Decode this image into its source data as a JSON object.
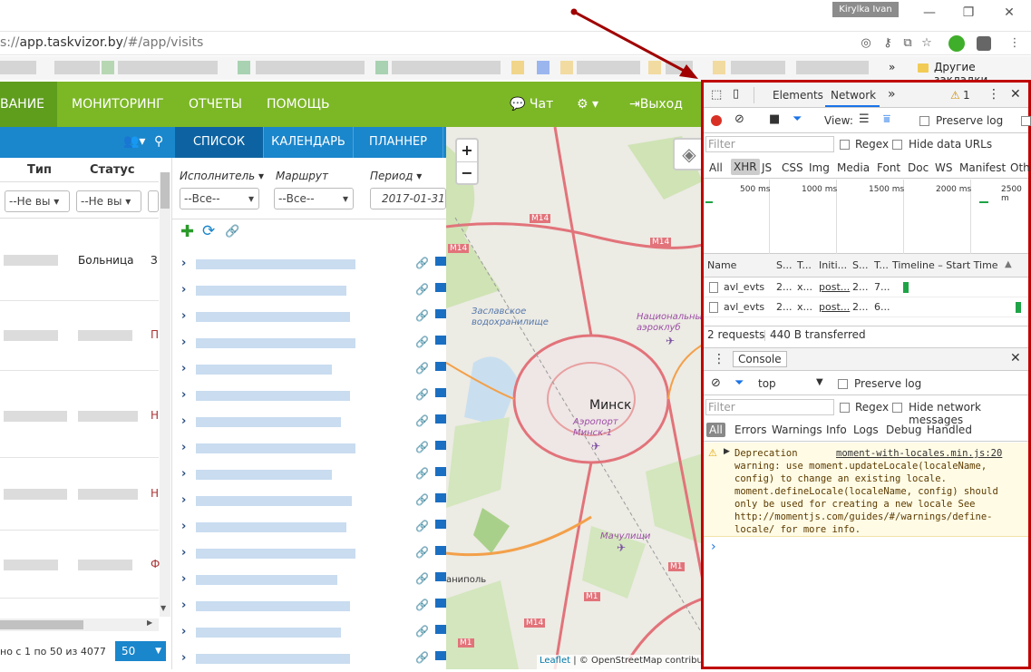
{
  "browser": {
    "user_chip": "Kirylka Ivan",
    "url_prefix": "s://",
    "url_main": "app.taskvizor.by",
    "url_rest": "/#/app/visits",
    "bookmarks_more": "»",
    "bookmarks_folder": "Другие закладки"
  },
  "nav": {
    "items": [
      "ВАНИЕ",
      "МОНИТОРИНГ",
      "ОТЧЕТЫ",
      "ПОМОЩЬ"
    ],
    "chat": "Чат",
    "logout": "Выход"
  },
  "left_grid": {
    "col_type": "Тип",
    "col_status": "Статус",
    "filter_type": "--Не вы",
    "filter_status": "--Не вы",
    "row1_status": "Больница",
    "row1_extra": "З",
    "row_extras": [
      "П",
      "Н",
      "Н",
      "Ф"
    ],
    "pager_text": "но с 1 по 50 из 4077",
    "page_size": "50"
  },
  "tabs": [
    "СПИСОК",
    "КАЛЕНДАРЬ",
    "ПЛАННЕР"
  ],
  "filters": {
    "executor_label": "Исполнитель",
    "route_label": "Маршрут",
    "period_label": "Период",
    "executor_value": "--Все--",
    "route_value": "--Все--",
    "period_value": "2017-01-31"
  },
  "map": {
    "zoom_in": "+",
    "zoom_out": "−",
    "city": "Минск",
    "airport": "Аэропорт Минск-1",
    "reservoir": "Заславское водохранилище",
    "national_airport": "Национальный аэроклуб",
    "machulishchy": "Мачулищи",
    "annopol": "аниполь",
    "roads": [
      "M14",
      "M14",
      "M14",
      "M14",
      "M1",
      "M1",
      "M1"
    ],
    "attribution_link": "Leaflet",
    "attribution_rest": "| © OpenStreetMap contribute"
  },
  "devtools": {
    "tabs": [
      "Elements",
      "Network"
    ],
    "more": "»",
    "warn_count": "1",
    "view_label": "View:",
    "preserve_log": "Preserve log",
    "filter_placeholder": "Filter",
    "regex": "Regex",
    "hide_data_urls": "Hide data URLs",
    "types": [
      "All",
      "XHR",
      "JS",
      "CSS",
      "Img",
      "Media",
      "Font",
      "Doc",
      "WS",
      "Manifest",
      "Oth"
    ],
    "timeline_ticks": [
      "500 ms",
      "1000 ms",
      "1500 ms",
      "2000 ms",
      "2500 m"
    ],
    "columns": [
      "Name",
      "S...",
      "T...",
      "Initi...",
      "S...",
      "T...",
      "Timeline – Start Time"
    ],
    "requests": [
      {
        "name": "avl_evts",
        "status": "2...",
        "type": "x...",
        "initiator": "post...",
        "size": "2...",
        "time": "7..."
      },
      {
        "name": "avl_evts",
        "status": "2...",
        "type": "x...",
        "initiator": "post...",
        "size": "2...",
        "time": "6..."
      }
    ],
    "summary_requests": "2 requests",
    "summary_transferred": "440 B transferred",
    "console_tab": "Console",
    "context": "top",
    "console_preserve": "Preserve log",
    "hide_network": "Hide network messages",
    "levels": [
      "All",
      "Errors",
      "Warnings",
      "Info",
      "Logs",
      "Debug",
      "Handled"
    ],
    "message_lines": [
      "Deprecation",
      "warning: use moment.updateLocale(localeName,",
      "config) to change an existing locale.",
      "moment.defineLocale(localeName, config) should",
      "only be used for creating a new locale See",
      "http://momentjs.com/guides/#/warnings/define-",
      "locale/ for more info."
    ],
    "message_source": "moment-with-locales.min.js:20",
    "prompt": "›"
  },
  "colors": {
    "nav_green": "#7cb726",
    "blue_header": "#1a86cc",
    "highlight": "#c00000"
  }
}
